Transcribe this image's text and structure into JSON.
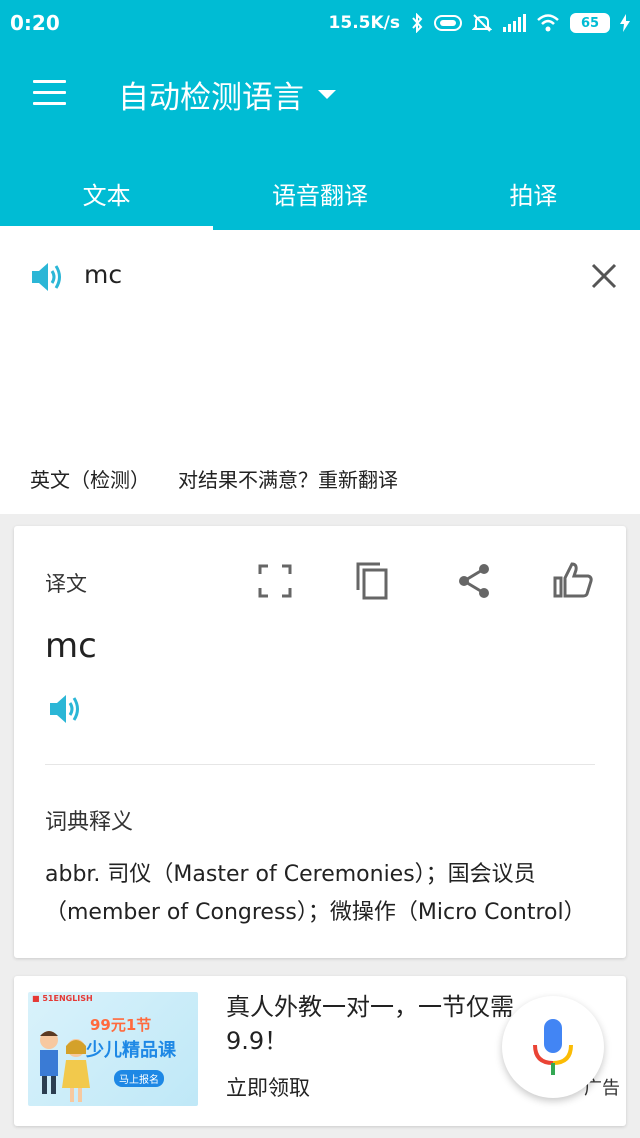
{
  "status_bar": {
    "time": "0:20",
    "network_speed": "15.5K/s",
    "battery_level": "65",
    "icons": [
      "bluetooth-icon",
      "hd-icon",
      "mute-icon",
      "signal-icon",
      "wifi-icon",
      "battery-icon",
      "charging-icon"
    ]
  },
  "header": {
    "language_selector": "自动检测语言",
    "tabs": [
      {
        "label": "文本",
        "active": true
      },
      {
        "label": "语音翻译",
        "active": false
      },
      {
        "label": "拍译",
        "active": false
      }
    ],
    "accent_color": "#00bcd4"
  },
  "input": {
    "text": "mc",
    "detected_language": "英文（检测）",
    "retranslate_prompt": "对结果不满意？重新翻译"
  },
  "result_card": {
    "title": "译文",
    "translation": "mc",
    "dict_title": "词典释义",
    "dict_text": "abbr. 司仪（Master of Ceremonies）；国会议员（member of Congress）；微操作（Micro Control）"
  },
  "ad": {
    "title": "真人外教一对一，一节仅需9.9！",
    "cta": "立即领取",
    "tag": "广告",
    "image_badge": "99元1节",
    "image_headline": "少儿精品课",
    "image_signup": "马上报名"
  }
}
